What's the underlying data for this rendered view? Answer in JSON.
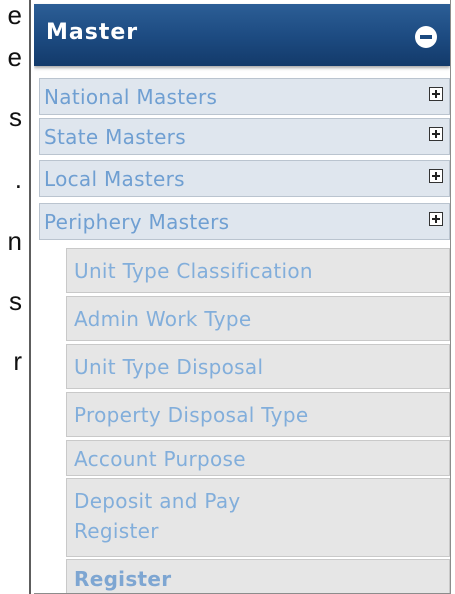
{
  "left_clipped_text": [
    "e",
    "e",
    "s",
    ".",
    "n",
    "s",
    "r"
  ],
  "menu": {
    "title": "Master",
    "collapse_icon": "minus-circle-icon",
    "items": [
      {
        "label": "National Masters",
        "icon": "expand-plus-icon"
      },
      {
        "label": "State Masters",
        "icon": "expand-plus-icon"
      },
      {
        "label": "Local Masters",
        "icon": "expand-plus-icon"
      },
      {
        "label": "Periphery Masters",
        "icon": "expand-plus-icon"
      }
    ],
    "subitems": [
      {
        "label": "Unit Type Classification"
      },
      {
        "label": "Admin Work Type"
      },
      {
        "label": "Unit Type Disposal"
      },
      {
        "label": "Property Disposal Type"
      },
      {
        "label": "Account Purpose"
      },
      {
        "label": "Deposit and Pay Register"
      },
      {
        "label": "Register"
      }
    ]
  },
  "colors": {
    "header": "#1c4a80",
    "item_bg": "#dfe6ee",
    "item_text": "#6f9fd2",
    "subitem_bg": "#e6e6e6",
    "subitem_text": "#82aedb"
  }
}
